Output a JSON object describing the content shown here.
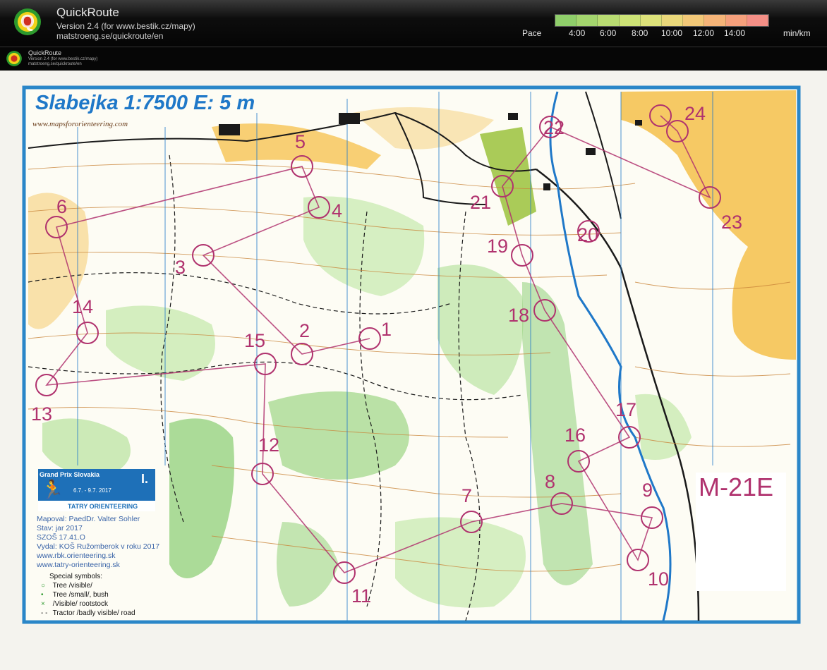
{
  "header": {
    "app_title": "QuickRoute",
    "version": "Version 2.4  (for www.bestik.cz/mapy)",
    "url": "matstroeng.se/quickroute/en",
    "pace_label": "Pace",
    "pace_ticks": [
      "4:00",
      "6:00",
      "8:00",
      "10:00",
      "12:00",
      "14:00"
    ],
    "pace_unit": "min/km",
    "pace_colors": [
      "#8fce6a",
      "#a4d56e",
      "#b9dc72",
      "#cde376",
      "#dde27a",
      "#ead87a",
      "#f2c878",
      "#f5b478",
      "#f5a07c",
      "#f48f86"
    ]
  },
  "subheader": {
    "app_title": "QuickRoute",
    "version": "Version 2.4  (for www.bestik.cz/mapy)",
    "url": "matstroeng.se/quickroute/en"
  },
  "map": {
    "title": "Slabejka 1:7500  E: 5 m",
    "website": "www.mapsfororienteering.com",
    "class": "M-21E",
    "controls": [
      "1",
      "2",
      "3",
      "4",
      "5",
      "6",
      "7",
      "8",
      "9",
      "10",
      "11",
      "12",
      "13",
      "14",
      "15",
      "16",
      "17",
      "18",
      "19",
      "20",
      "21",
      "22",
      "23",
      "24"
    ],
    "event": {
      "title": "Grand Prix Slovakia",
      "dates": "6.7. - 9.7.   2017",
      "roman": "I.",
      "org": "TATRY ORIENTEERING"
    },
    "info_lines": [
      "Mapoval: PaedDr. Valter Sohler",
      "Stav: jar 2017",
      "SZOŠ 17.41.O",
      "Vydal: KOŠ Ružomberok v roku 2017",
      "www.rbk.orienteering.sk",
      "www.tatry-orienteering.sk"
    ],
    "legend": {
      "title": "Special symbols:",
      "items": [
        {
          "symbol": "○",
          "label": "Tree /visible/",
          "color": "#2f9a2f"
        },
        {
          "symbol": "•",
          "label": "Tree /small/, bush",
          "color": "#2f9a2f"
        },
        {
          "symbol": "×",
          "label": "/Visible/ rootstock",
          "color": "#2f9a2f"
        },
        {
          "symbol": "- -",
          "label": "Tractor /badly visible/ road",
          "color": "#111111"
        }
      ]
    },
    "colors": {
      "course": "#b0326e",
      "water": "#1f78c8",
      "open_land": "#f5c04a",
      "vegetation": "#8fd07a",
      "frame": "#2a86c8"
    }
  }
}
